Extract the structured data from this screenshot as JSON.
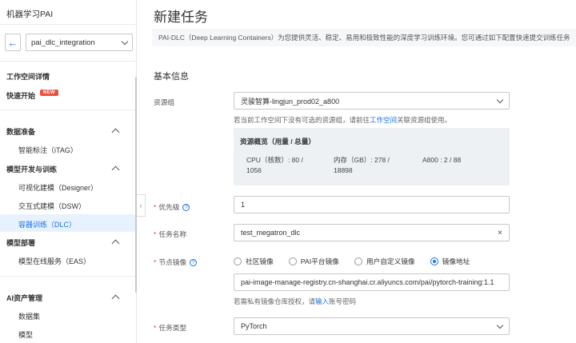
{
  "sidebar": {
    "title": "机器学习PAI",
    "workspace": "pai_dlc_integration",
    "items": {
      "workspace_detail": "工作空间详情",
      "quick_start": "快速开始",
      "new_badge": "NEW",
      "data_prep": "数据准备",
      "itag": "智能标注（iTAG）",
      "model_dev": "模型开发与训练",
      "designer": "可视化建模（Designer）",
      "dsw": "交互式建模（DSW）",
      "dlc": "容器训练（DLC）",
      "model_deploy": "模型部署",
      "eas": "模型在线服务（EAS）",
      "ai_assets": "AI资产管理",
      "dataset": "数据集",
      "model": "模型"
    }
  },
  "main": {
    "title": "新建任务",
    "description": "PAI-DLC（Deep Learning Containers）为您提供灵活、稳定、易用和极致性能的深度学习训练环境。您可通过如下配置快速提交训练任务",
    "section_basic": "基本信息",
    "resource_group": {
      "label": "资源组",
      "value": "灵骏智算-lingjun_prod02_a800",
      "hint_prefix": "若当前工作空间下没有可选的资源组，请前往",
      "hint_link": "工作空间",
      "hint_suffix": "关联资源组使用。"
    },
    "resource_overview": {
      "title": "资源概览（用量 / 总量）",
      "cpu_line1": "CPU（核数）: 80 /",
      "cpu_line2": "1056",
      "mem_line1": "内存（GB）: 278 /",
      "mem_line2": "18898",
      "gpu": "A800 : 2 / 88"
    },
    "priority": {
      "label": "优先级",
      "value": "1"
    },
    "task_name": {
      "label": "任务名称",
      "value": "test_megatron_dlc"
    },
    "node_image": {
      "label": "节点镜像",
      "options": [
        "社区镜像",
        "PAI平台镜像",
        "用户自定义镜像",
        "镜像地址"
      ],
      "selected": 3,
      "value": "pai-image-manage-registry.cn-shanghai.cr.aliyuncs.com/pai/pytorch-training:1.1",
      "hint_prefix": "若需私有镜像仓库授权，请",
      "hint_link": "输入",
      "hint_suffix": "账号密码"
    },
    "task_type": {
      "label": "任务类型",
      "value": "PyTorch"
    }
  },
  "colors": {
    "accent": "#1874e8",
    "required": "#e03e2d",
    "badge": "#e8513e"
  }
}
